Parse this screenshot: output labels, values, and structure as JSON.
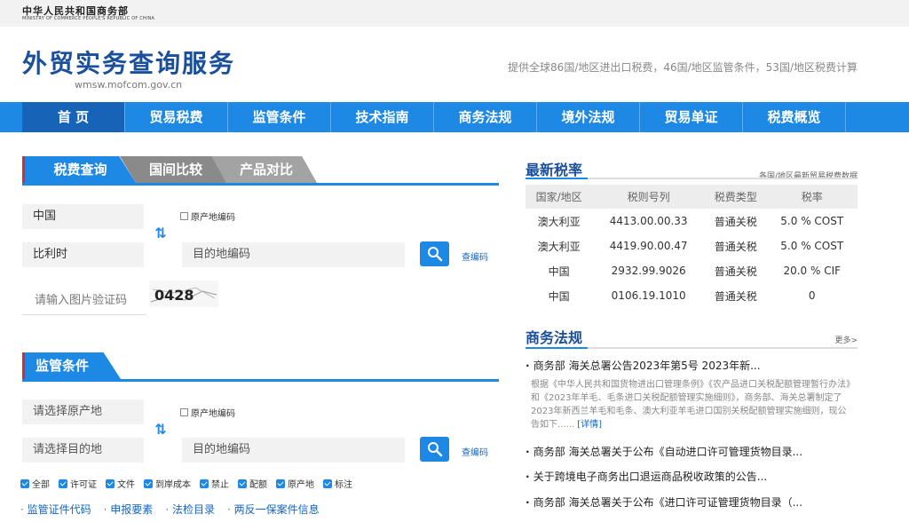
{
  "header": {
    "ministry_cn": "中华人民共和国商务部",
    "ministry_en": "MINISTRY OF COMMERCE PEOPLE'S REPUBLIC OF CHINA",
    "site_title": "外贸实务查询服务",
    "domain": "wmsw.mofcom.gov.cn",
    "description": "提供全球86国/地区进出口税费，46国/地区监管条件，53国/地区税费计算"
  },
  "nav": [
    "首 页",
    "贸易税费",
    "监管条件",
    "技术指南",
    "商务法规",
    "境外法规",
    "贸易单证",
    "税费概览"
  ],
  "tariff_query": {
    "tabs": [
      "税费查询",
      "国间比较",
      "产品对比"
    ],
    "origin_value": "中国",
    "origin_code_label": "原产地编码",
    "dest_value": "比利时",
    "dest_code_placeholder": "目的地编码",
    "lookup_code": "查编码",
    "captcha_placeholder": "请输入图片验证码",
    "captcha_text": "0428"
  },
  "regulation_query": {
    "title": "监管条件",
    "origin_placeholder": "请选择原产地",
    "origin_code_label": "原产地编码",
    "dest_placeholder": "请选择目的地",
    "dest_code_placeholder": "目的地编码",
    "lookup_code": "查编码",
    "filters": [
      "全部",
      "许可证",
      "文件",
      "到岸成本",
      "禁止",
      "配额",
      "原产地",
      "标注"
    ]
  },
  "bottom_links": [
    "监管证件代码",
    "申报要素",
    "法检目录",
    "两反一保案件信息"
  ],
  "latest_rates": {
    "title": "最新税率",
    "note": "各国/地区最新贸易税费数据",
    "columns": [
      "国家/地区",
      "税则号列",
      "税费类型",
      "税率"
    ],
    "rows": [
      [
        "澳大利亚",
        "4413.00.00.33",
        "普通关税",
        "5.0 % COST"
      ],
      [
        "澳大利亚",
        "4419.90.00.47",
        "普通关税",
        "5.0 % COST"
      ],
      [
        "中国",
        "2932.99.9026",
        "普通关税",
        "20.0 % CIF"
      ],
      [
        "中国",
        "0106.19.1010",
        "普通关税",
        "0"
      ]
    ]
  },
  "commerce_law": {
    "title": "商务法规",
    "more": "更多>",
    "items": [
      "商务部 海关总署公告2023年第5号 2023年新...",
      "商务部 海关总署关于公布《自动进口许可管理货物目录...",
      "关于跨境电子商务出口退运商品税收政策的公告...",
      "商务部 海关总署关于公布《进口许可证管理货物目录（..."
    ],
    "first_desc": "根据《中华人民共和国货物进出口管理条例》《农产品进口关税配额管理暂行办法》和《2023年羊毛、毛条进口关税配额管理实施细则》，商务部、海关总署制定了2023年新西兰羊毛和毛条、澳大利亚羊毛进口国别关税配额管理实施细则，现公告如下......",
    "detail_link": "[详情]"
  },
  "colors": {
    "brand": "#1a4f9c",
    "nav": "#1e88e5",
    "accent": "#d32f2f"
  }
}
